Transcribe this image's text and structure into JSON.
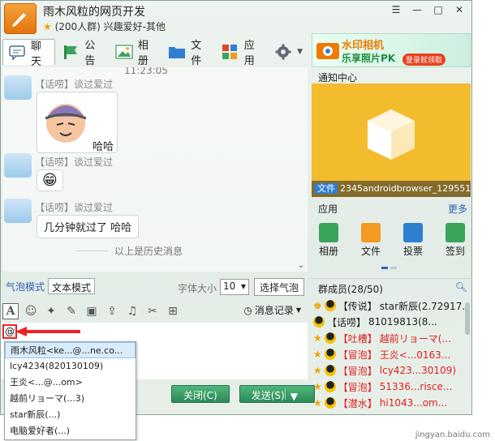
{
  "window": {
    "group_name": "雨木风粒的网页开发",
    "group_meta": "(200人群) 兴趣爱好-其他",
    "controls": {
      "skin": "☰",
      "minimize": "—",
      "maximize": "□",
      "close": "✕"
    }
  },
  "tabs": [
    {
      "label": "聊天",
      "icon": "chat-icon"
    },
    {
      "label": "公告",
      "icon": "announcement-icon"
    },
    {
      "label": "相册",
      "icon": "album-icon"
    },
    {
      "label": "文件",
      "icon": "folder-icon"
    },
    {
      "label": "应用",
      "icon": "apps-icon"
    },
    {
      "label": "",
      "icon": "settings-icon"
    }
  ],
  "chat": {
    "time": "11:23:05",
    "messages": [
      {
        "sender": "【话唠】谈过爱过",
        "content": "哈哈",
        "type": "sticker"
      },
      {
        "sender": "【话唠】谈过爱过",
        "content": "😁",
        "type": "emoji"
      },
      {
        "sender": "【话唠】谈过爱过",
        "content": "几分钟就过了  哈哈",
        "type": "text"
      }
    ],
    "history_note": "以上是历史消息"
  },
  "input_toolbar": {
    "bubble_mode": "气泡模式",
    "text_mode": "文本模式",
    "font_size_label": "字体大小",
    "font_size_value": "10",
    "select_bubble": "选择气泡",
    "message_record": "消息记录",
    "tools": [
      "font-icon",
      "emoji-icon",
      "magic-icon",
      "edit-icon",
      "image-icon",
      "upload-icon",
      "music-icon",
      "screenshot-icon",
      "gamepad-icon"
    ]
  },
  "input": {
    "text": "@"
  },
  "mention_list": [
    "雨木风粒<ke...@...ne.co...",
    "lcy4234(820130109)",
    "王炎<...@...om>",
    "越前リョーマ(...3)",
    "star新辰(...)",
    "电脑爱好者(...)"
  ],
  "buttons": {
    "close": "关闭(C)",
    "send": "发送(S)",
    "send_arrow": "▼"
  },
  "right": {
    "ad": {
      "title": "水印相机",
      "subtitle": "乐享照片PK",
      "button": "登录就领取"
    },
    "notify_title": "通知中心",
    "file_badge": "文件",
    "file_name": "2345androidbrowser_129551",
    "apps_title": "应用",
    "apps_more": "更多",
    "apps": [
      {
        "label": "相册",
        "color": "#3aa55a"
      },
      {
        "label": "文件",
        "color": "#f39a22"
      },
      {
        "label": "投票",
        "color": "#2f7fd0"
      },
      {
        "label": "签到",
        "color": "#3aa55a"
      }
    ],
    "members_title": "群成员(28/50)",
    "members": [
      {
        "role": "【传说】",
        "name": "star新辰(2.72917...",
        "red": false
      },
      {
        "role": "【话唠】",
        "name": "81019813(8...",
        "red": false
      },
      {
        "role": "【吐槽】",
        "name": "越前リョーマ(...",
        "red": true
      },
      {
        "role": "【冒泡】",
        "name": "王炎<...0163...",
        "red": true
      },
      {
        "role": "【冒泡】",
        "name": "lcy423...30109)",
        "red": true
      },
      {
        "role": "【冒泡】",
        "name": "51336...risce...",
        "red": true
      },
      {
        "role": "【潜水】",
        "name": "hi1043...om...",
        "red": true
      }
    ],
    "watermark": "jingyan.baidu.com"
  }
}
